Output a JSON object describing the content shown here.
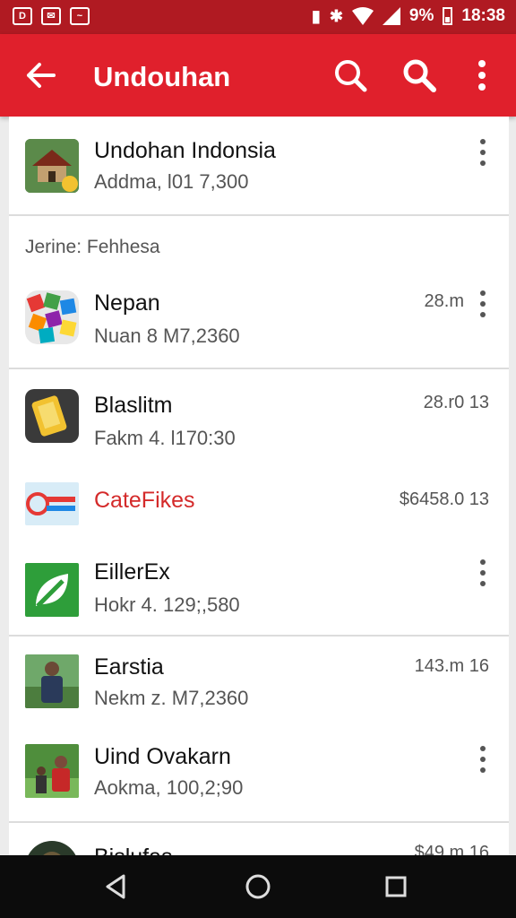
{
  "status_bar": {
    "percent": "9%",
    "time": "18:38"
  },
  "app_bar": {
    "title": "Undouhan"
  },
  "items": [
    {
      "name": "Undohan Indonsia",
      "meta": "Addma, l01 7,300",
      "size": ""
    },
    {
      "name": "Nepan",
      "meta": "Nuan 8 M7,2360",
      "size": "28.m"
    },
    {
      "name": "Blaslitm",
      "meta": "Fakm 4. l170:30",
      "size": "28.r0 13"
    },
    {
      "name": "CateFikes",
      "meta": "",
      "size": "$6458.0 13",
      "accent": "#d42a2a"
    },
    {
      "name": "EillerEx",
      "meta": "Hokr 4. 129;,580",
      "size": ""
    },
    {
      "name": "Earstia",
      "meta": "Nekm z. M7,2360",
      "size": "143.m 16"
    },
    {
      "name": "Uind Ovakarn",
      "meta": "Aokma, 100,2;90",
      "size": ""
    },
    {
      "name": "Bislufas",
      "meta": "",
      "size": "$49.m 16"
    }
  ],
  "section_header": "Jerine: Fehhesa",
  "colors": {
    "app_bar": "#e0202c",
    "status_bar": "#b01a22",
    "nav_bar": "#0c0c0c"
  },
  "icons": [
    "back-arrow-icon",
    "search-icon",
    "more-vert-icon",
    "nav-back-icon",
    "nav-home-icon",
    "nav-recents-icon"
  ]
}
